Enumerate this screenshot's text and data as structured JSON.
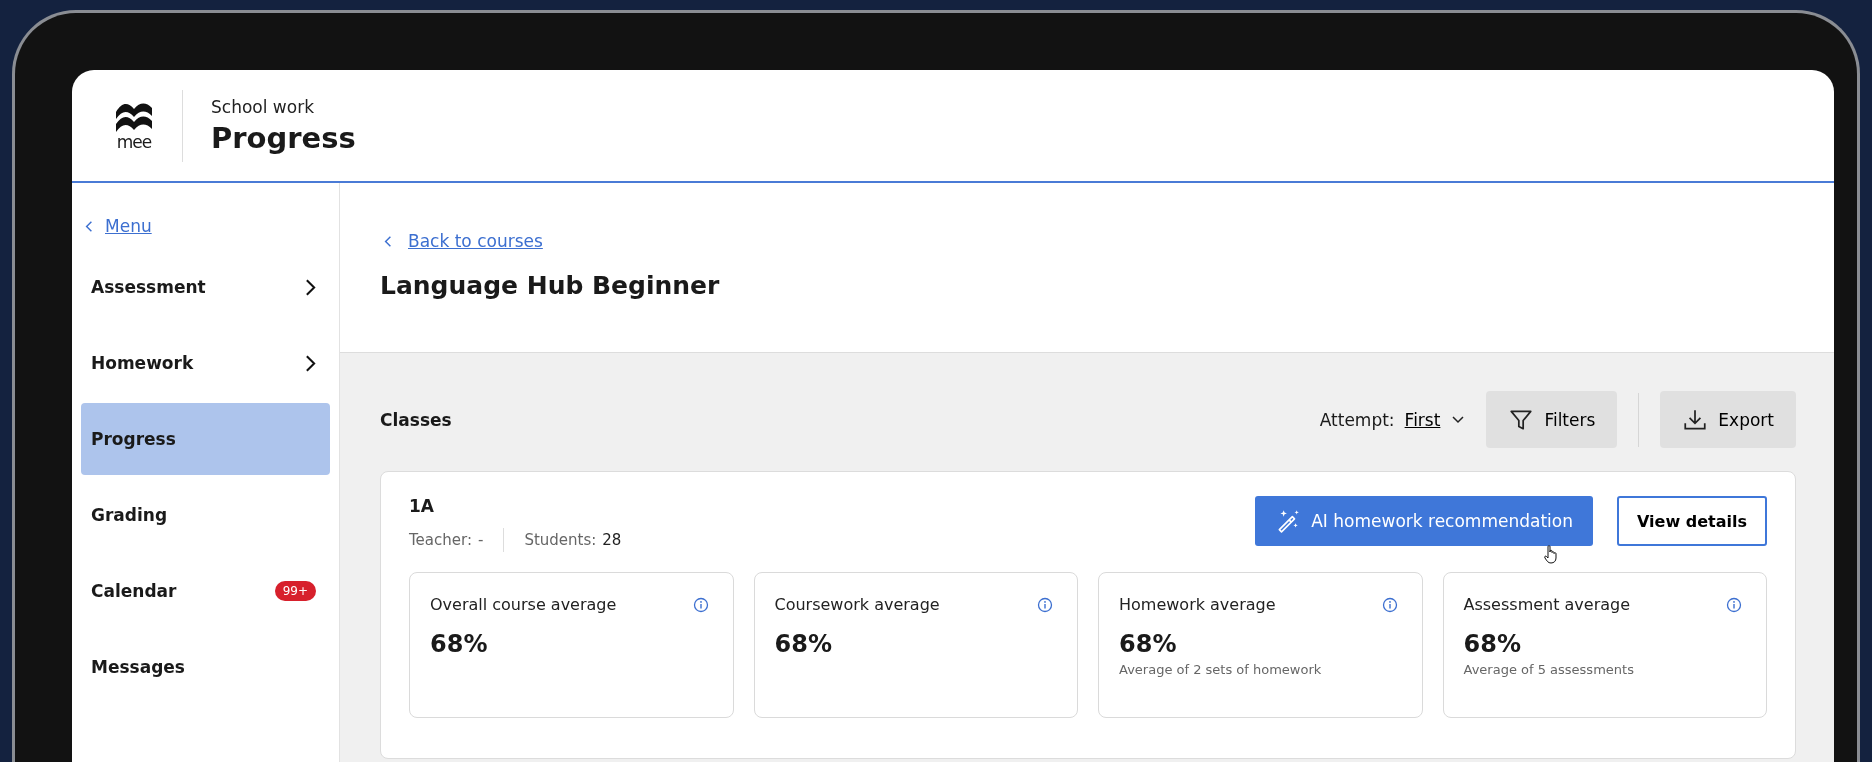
{
  "header": {
    "logo_text": "mee",
    "section": "School work",
    "title": "Progress"
  },
  "sidebar": {
    "back_link": "Menu",
    "items": [
      {
        "label": "Assessment",
        "kind": "submenu",
        "selected": false
      },
      {
        "label": "Homework",
        "kind": "submenu",
        "selected": false
      },
      {
        "label": "Progress",
        "kind": "plain",
        "selected": true
      },
      {
        "label": "Grading",
        "kind": "plain",
        "selected": false
      },
      {
        "label": "Calendar",
        "kind": "badge",
        "badge": "99+",
        "selected": false
      },
      {
        "label": "Messages",
        "kind": "plain",
        "selected": false
      }
    ]
  },
  "main": {
    "back_link": "Back to courses",
    "course_title": "Language Hub Beginner"
  },
  "toolbar": {
    "section_title": "Classes",
    "attempt_label": "Attempt:",
    "attempt_value": "First",
    "buttons": [
      {
        "label": "Filters",
        "kind": "filter"
      },
      {
        "label": "Export",
        "kind": "export"
      }
    ]
  },
  "class_card": {
    "name": "1A",
    "teacher_label": "Teacher:",
    "teacher_value": "-",
    "students_label": "Students:",
    "students_value": "28",
    "ai_button": "AI homework recommendation",
    "details_button": "View details",
    "stats": [
      {
        "label": "Overall course average",
        "value": "68%"
      },
      {
        "label": "Coursework average",
        "value": "68%"
      },
      {
        "label": "Homework average",
        "value": "68%",
        "note": "Average of 2 sets of homework"
      },
      {
        "label": "Assessment average",
        "value": "68%",
        "note": "Average of 5 assessments"
      }
    ]
  }
}
